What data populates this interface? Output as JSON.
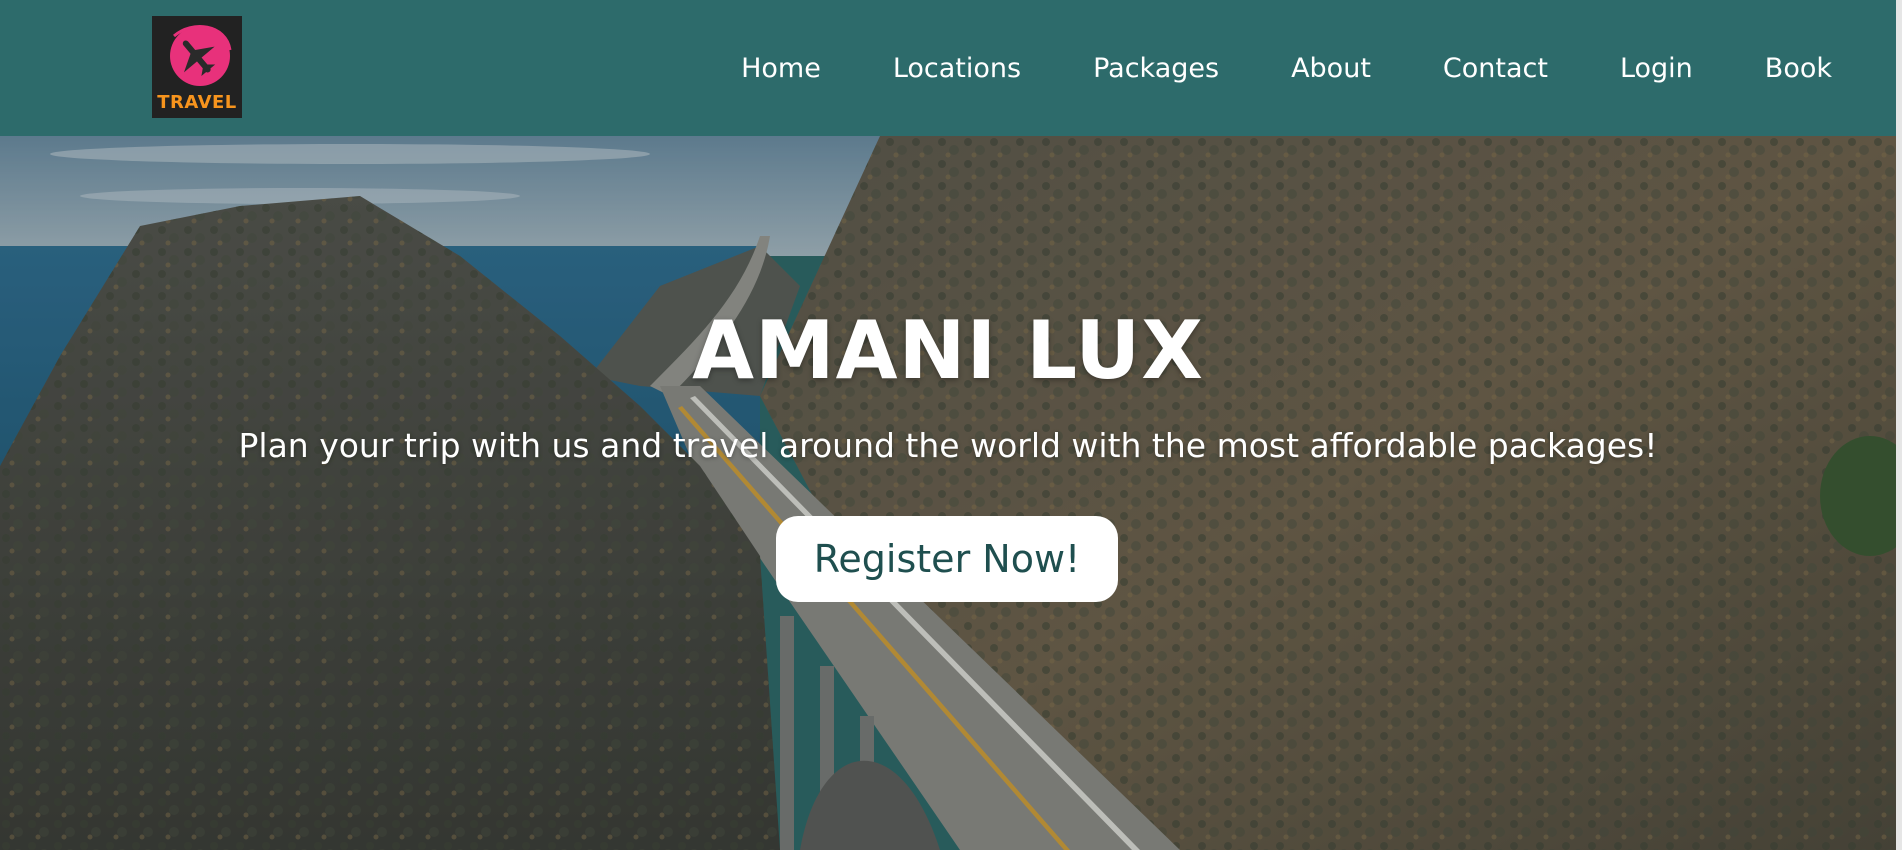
{
  "navbar": {
    "logo": {
      "text": "TRAVEL",
      "icon": "airplane-icon",
      "colors": {
        "background": "#222222",
        "circle": "#e8317b",
        "text": "#f7941d"
      }
    },
    "links": [
      {
        "label": "Home"
      },
      {
        "label": "Locations"
      },
      {
        "label": "Packages"
      },
      {
        "label": "About"
      },
      {
        "label": "Contact"
      },
      {
        "label": "Login"
      },
      {
        "label": "Book"
      }
    ],
    "background": "#2d6b6b"
  },
  "hero": {
    "title": "AMANI LUX",
    "subtitle": "Plan your trip with us and travel around the world with the most affordable packages!",
    "cta_label": "Register Now!",
    "background_image": "coastal-mountain-road-bridge"
  }
}
